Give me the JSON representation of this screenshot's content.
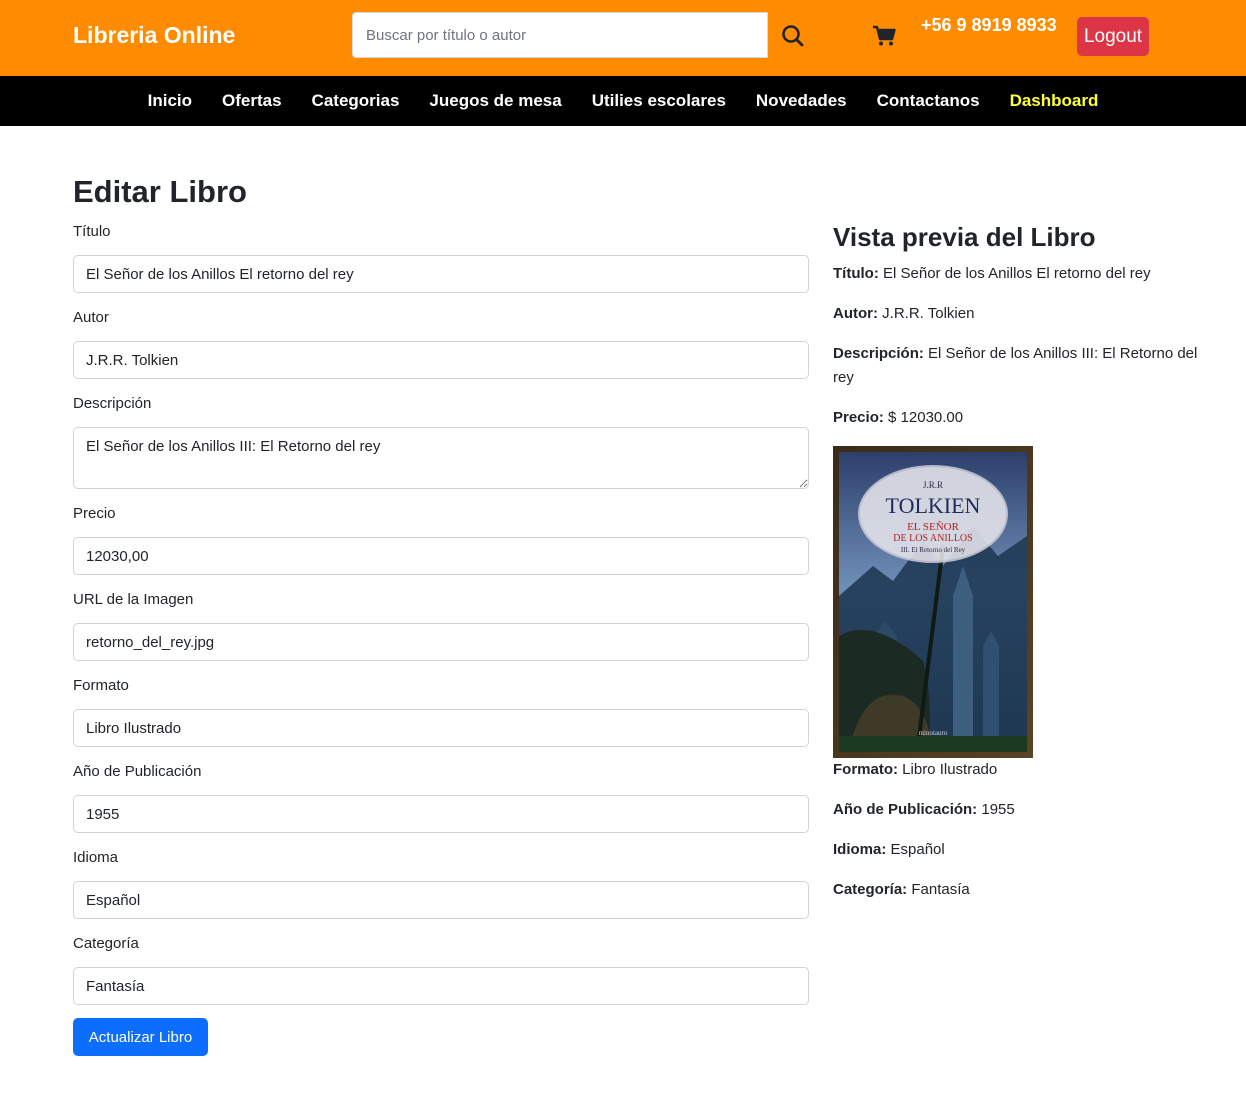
{
  "header": {
    "brand": "Libreria Online",
    "search_placeholder": "Buscar por título o autor",
    "phone": "+56 9 8919 8933",
    "logout_label": "Logout"
  },
  "nav": {
    "items": [
      "Inicio",
      "Ofertas",
      "Categorias",
      "Juegos de mesa",
      "Utilies escolares",
      "Novedades",
      "Contactanos",
      "Dashboard"
    ]
  },
  "form": {
    "title": "Editar Libro",
    "fields": [
      {
        "label": "Título",
        "value": "El Señor de los Anillos El retorno del rey"
      },
      {
        "label": "Autor",
        "value": "J.R.R. Tolkien"
      },
      {
        "label": "Descripción",
        "value": "El Señor de los Anillos III: El Retorno del rey"
      },
      {
        "label": "Precio",
        "value": "12030,00"
      },
      {
        "label": "URL de la Imagen",
        "value": "retorno_del_rey.jpg"
      },
      {
        "label": "Formato",
        "value": "Libro Ilustrado"
      },
      {
        "label": "Año de Publicación",
        "value": "1955"
      },
      {
        "label": "Idioma",
        "value": "Español"
      },
      {
        "label": "Categoría",
        "value": "Fantasía"
      }
    ],
    "submit_label": "Actualizar Libro"
  },
  "preview": {
    "title": "Vista previa del Libro",
    "items": [
      {
        "label": "Título:",
        "value": "El Señor de los Anillos El retorno del rey"
      },
      {
        "label": "Autor:",
        "value": "J.R.R. Tolkien"
      },
      {
        "label": "Descripción:",
        "value": "El Señor de los Anillos III: El Retorno del rey"
      },
      {
        "label": "Precio:",
        "value": "$ 12030.00"
      },
      {
        "label": "Formato:",
        "value": "Libro Ilustrado"
      },
      {
        "label": "Año de Publicación:",
        "value": "1955"
      },
      {
        "label": "Idioma:",
        "value": "Español"
      },
      {
        "label": "Categoría:",
        "value": "Fantasía"
      }
    ],
    "cover": {
      "author_small": "J.R.R",
      "author": "TOLKIEN",
      "title_line1": "EL SEÑOR",
      "title_line2": "DE LOS ANILLOS",
      "subtitle": "III. El Retorno del Rey",
      "publisher": "minotauro"
    }
  },
  "icons": {
    "search": "search-icon",
    "cart": "cart-icon"
  },
  "colors": {
    "topbar": "#ff8c00",
    "navbar": "#000000",
    "dashboard_link": "#ffff33",
    "logout": "#dc3545",
    "primary": "#0d6efd"
  }
}
